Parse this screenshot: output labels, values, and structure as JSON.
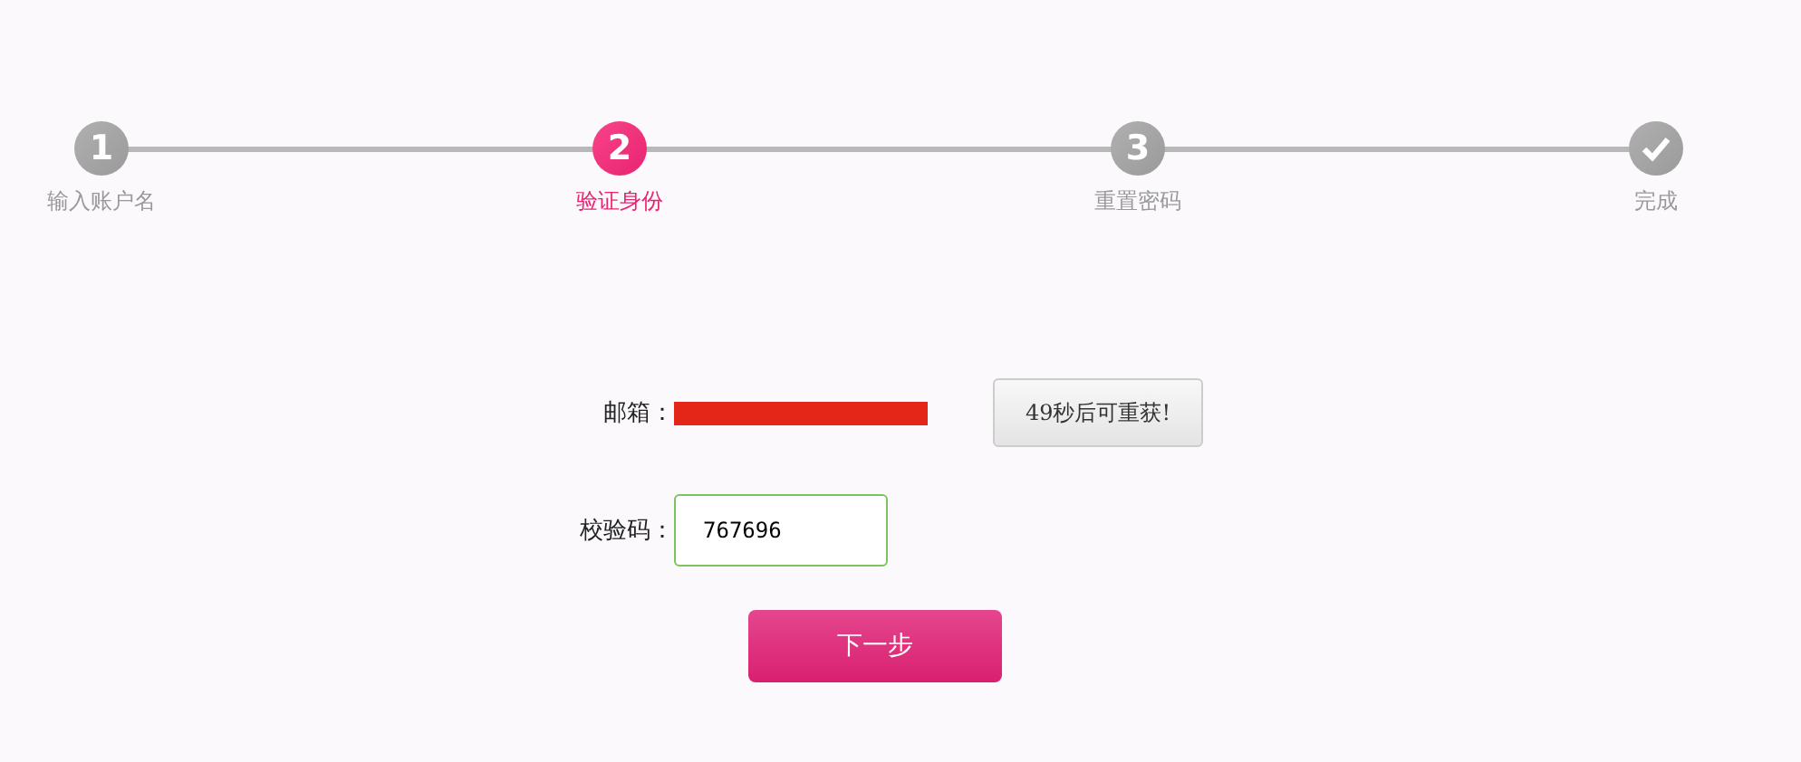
{
  "steps": [
    {
      "kind": "number",
      "number": "1",
      "label": "输入账户名",
      "selected": false
    },
    {
      "kind": "number",
      "number": "2",
      "label": "验证身份",
      "selected": true
    },
    {
      "kind": "number",
      "number": "3",
      "label": "重置密码",
      "selected": false
    },
    {
      "kind": "done",
      "label": "完成",
      "selected": false
    }
  ],
  "email": {
    "label": "邮箱：",
    "redacted": true
  },
  "resend_button": {
    "label": "49秒后可重获!",
    "disabled": true
  },
  "code": {
    "label": "校验码：",
    "value": "767696"
  },
  "next_button": {
    "label": "下一步"
  }
}
